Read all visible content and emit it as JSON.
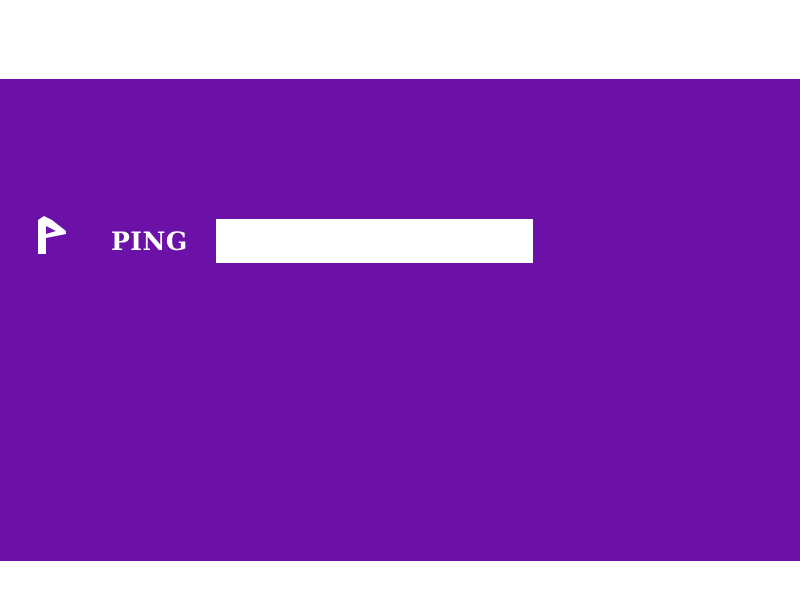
{
  "header": {
    "brand_name": "PING"
  },
  "search": {
    "value": "",
    "placeholder": ""
  },
  "icons": {
    "logo": "ping-logo-icon"
  },
  "colors": {
    "band_background": "#6b11a7",
    "page_background": "#ffffff",
    "brand_text": "#ffffff",
    "search_background": "#ffffff"
  }
}
